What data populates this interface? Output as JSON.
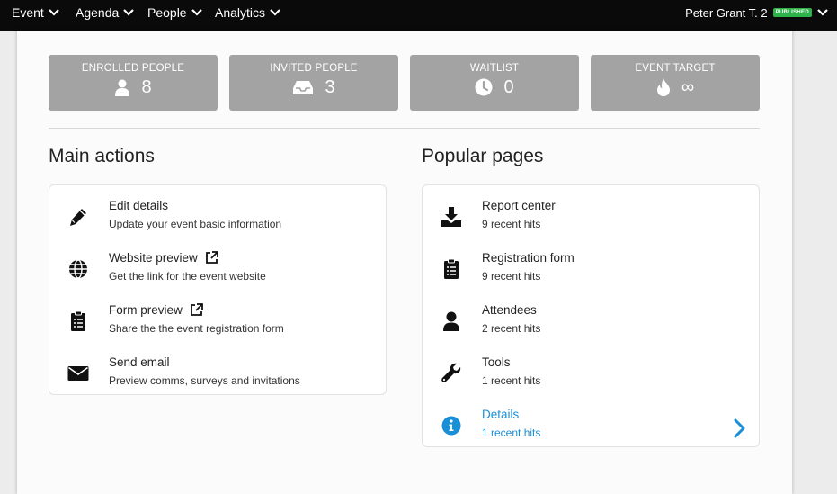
{
  "nav": {
    "items": [
      "Event",
      "Agenda",
      "People",
      "Analytics"
    ],
    "user_name": "Peter Grant T. 2",
    "status_badge": "PUBLISHED"
  },
  "stats": [
    {
      "label": "ENROLLED PEOPLE",
      "value": "8",
      "icon": "person-icon"
    },
    {
      "label": "INVITED PEOPLE",
      "value": "3",
      "icon": "inbox-icon"
    },
    {
      "label": "WAITLIST",
      "value": "0",
      "icon": "clock-icon"
    },
    {
      "label": "EVENT TARGET",
      "value": "∞",
      "icon": "flame-icon"
    }
  ],
  "main_actions": {
    "title": "Main actions",
    "items": [
      {
        "title": "Edit details",
        "subtitle": "Update your event basic information",
        "icon": "pencil-icon"
      },
      {
        "title": "Website preview",
        "subtitle": "Get the link for the event website",
        "icon": "globe-icon"
      },
      {
        "title": "Form preview",
        "subtitle": "Share the the event registration form",
        "icon": "clipboard-icon"
      },
      {
        "title": "Send email",
        "subtitle": "Preview comms, surveys and invitations",
        "icon": "envelope-icon"
      }
    ]
  },
  "popular_pages": {
    "title": "Popular pages",
    "items": [
      {
        "title": "Report center",
        "subtitle": "9 recent hits",
        "icon": "download-icon"
      },
      {
        "title": "Registration form",
        "subtitle": "9 recent hits",
        "icon": "clipboard-icon"
      },
      {
        "title": "Attendees",
        "subtitle": "2 recent hits",
        "icon": "person-icon"
      },
      {
        "title": "Tools",
        "subtitle": "1 recent hits",
        "icon": "wrench-icon"
      },
      {
        "title": "Details",
        "subtitle": "1 recent hits",
        "icon": "info-icon"
      }
    ]
  },
  "colors": {
    "topbar": "#0a0a0a",
    "stat_card": "#a3a3a3",
    "badge": "#2db34a",
    "accent": "#1a8fd6"
  }
}
